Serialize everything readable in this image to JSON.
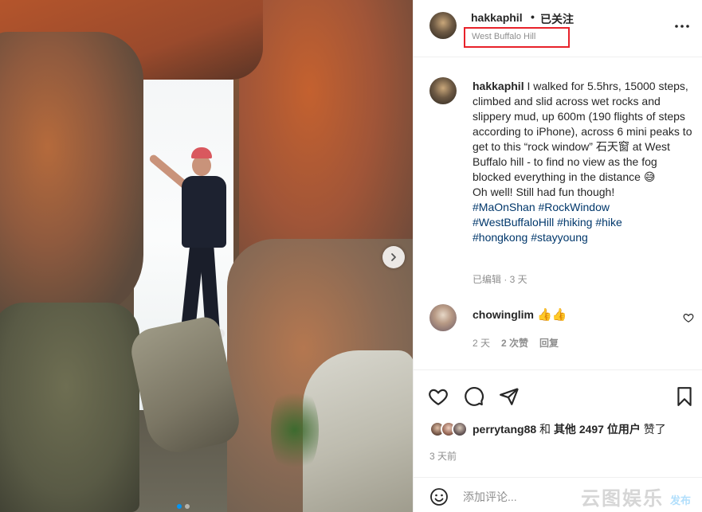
{
  "post": {
    "carousel": {
      "image_count": 2,
      "current_index": 1
    }
  },
  "header": {
    "username": "hakkaphil",
    "separator": "•",
    "follow_status": "已关注",
    "location": "West Buffalo Hill",
    "location_highlight_color": "#e8222a",
    "more_icon": "more-horizontal-icon"
  },
  "caption": {
    "username": "hakkaphil",
    "text_lines": [
      "I walked for 5.5hrs, 15000 steps, climbed and slid across wet rocks and slippery mud, up 600m (190 flights of steps according to iPhone), across 6 mini peaks to get to this “rock window” 石天窗 at West Buffalo hill - to find no view as the fog blocked everything in the distance"
    ],
    "emoji": "😅",
    "line2": "Oh well! Still had fun though!",
    "hashtags": [
      "#MaOnShan",
      "#RockWindow",
      "#WestBuffaloHill",
      "#hiking",
      "#hike",
      "#hongkong",
      "#stayyoung"
    ],
    "meta": "已编辑 · 3 天"
  },
  "comment": {
    "username": "chowinglim",
    "emoji": "👍👍",
    "time": "2 天",
    "likes": "2 次赞",
    "reply": "回复"
  },
  "likes": {
    "user": "perrytang88",
    "joiner": "和",
    "others": "其他 2497 位用户",
    "suffix": "赞了"
  },
  "timestamp": "3 天前",
  "add_comment": {
    "placeholder": "添加评论...",
    "post_label": "发布"
  },
  "watermark": "云图娱乐",
  "colors": {
    "hashtag": "#00376b",
    "muted": "#8e8e8e",
    "carousel_active": "#0095f6"
  }
}
